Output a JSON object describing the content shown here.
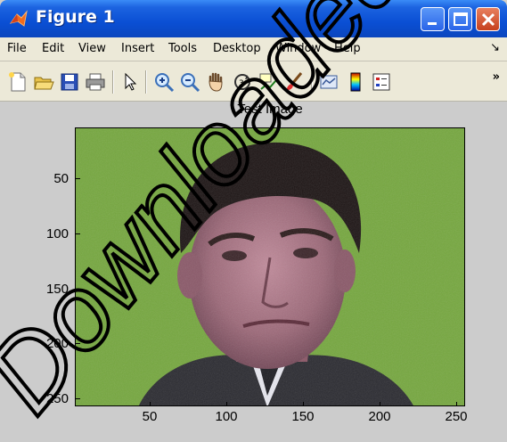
{
  "window": {
    "title": "Figure 1",
    "colors": {
      "titlebar": "#0a4fd4",
      "figure_bg": "#cccccc",
      "chrome": "#ece9d8"
    }
  },
  "menubar": {
    "items": [
      "File",
      "Edit",
      "View",
      "Insert",
      "Tools",
      "Desktop",
      "Window",
      "Help"
    ],
    "overflow": "↘"
  },
  "toolbar": {
    "tools": [
      "new-figure-icon",
      "open-file-icon",
      "save-icon",
      "print-icon",
      "edit-plot-arrow-icon",
      "zoom-in-icon",
      "zoom-out-icon",
      "pan-hand-icon",
      "rotate-3d-icon",
      "data-cursor-icon",
      "brush-icon",
      "link-plot-icon",
      "colorbar-icon",
      "legend-icon"
    ],
    "overflow": "»"
  },
  "axes": {
    "title": "Test Image",
    "yticks": [
      "50",
      "100",
      "150",
      "200",
      "250"
    ],
    "xticks": [
      "50",
      "100",
      "150",
      "200",
      "250"
    ],
    "image": "face-photo"
  },
  "watermark": {
    "text": "Downloaded from"
  }
}
